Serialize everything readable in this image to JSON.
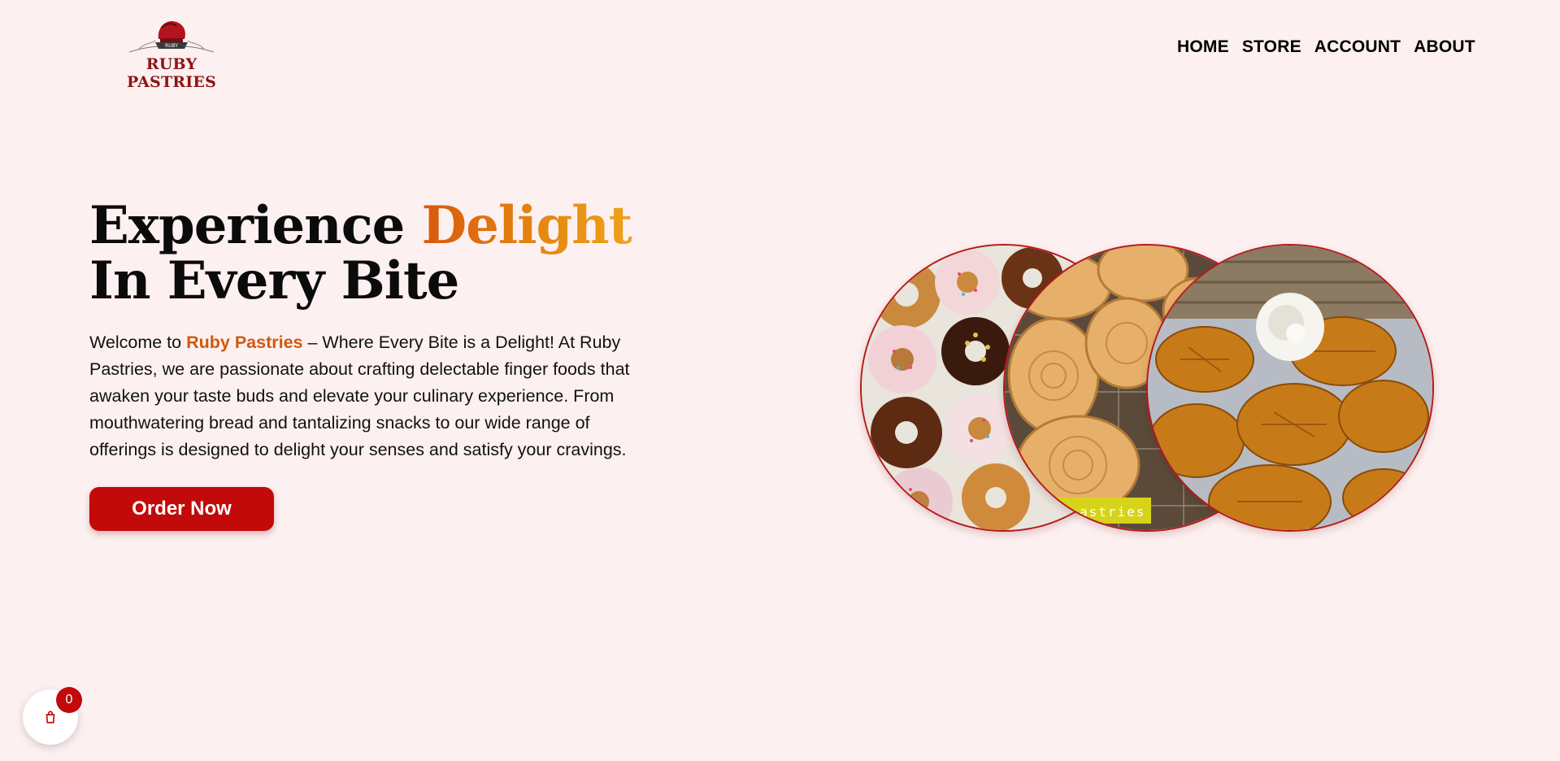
{
  "brand": {
    "name": "RUBY PASTRIES",
    "logo_badge": "RUBY"
  },
  "nav": {
    "home": "HOME",
    "store": "STORE",
    "account": "ACCOUNT",
    "about": "ABOUT"
  },
  "hero": {
    "title_part1": "Experience ",
    "title_accent": "Delight",
    "title_line2": "In Every Bite",
    "intro_prefix": "Welcome to ",
    "intro_brand": "Ruby Pastries",
    "intro_rest": " – Where Every Bite is a Delight! At Ruby Pastries, we are passionate about crafting delectable finger foods that awaken your taste buds and elevate your culinary experience. From mouthwatering bread and tantalizing snacks to our wide range of offerings is designed to delight your senses and satisfy your cravings.",
    "cta_label": "Order Now"
  },
  "gallery": {
    "photo_label": "astries"
  },
  "cart": {
    "count": "0"
  },
  "colors": {
    "accent": "#c20a0a",
    "brand_text": "#8e1414",
    "highlight": "#cf5a0f",
    "background": "#fdf0f0"
  }
}
